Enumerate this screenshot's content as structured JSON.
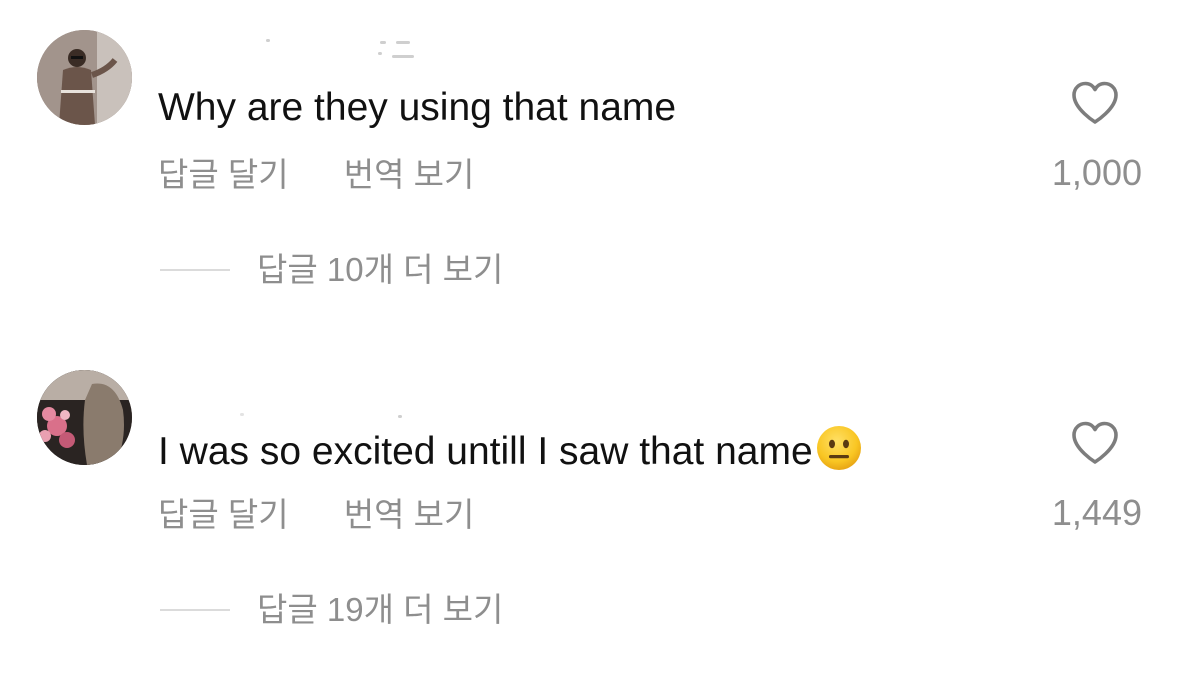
{
  "comments": [
    {
      "text": "Why are they using that name",
      "emoji": "",
      "reply_label": "답글 달기",
      "translate_label": "번역 보기",
      "like_count": "1,000",
      "view_replies_label": "답글 10개 더 보기"
    },
    {
      "text": "I was so excited untill I saw that name",
      "emoji": "😐",
      "reply_label": "답글 달기",
      "translate_label": "번역 보기",
      "like_count": "1,449",
      "view_replies_label": "답글 19개 더 보기"
    }
  ],
  "icons": {
    "like": "heart-outline-icon",
    "emoji": "neutral-face-emoji"
  },
  "colors": {
    "text": "#111111",
    "secondary_text": "#8e8e8e",
    "divider": "#dbdbdb",
    "background": "#ffffff"
  }
}
